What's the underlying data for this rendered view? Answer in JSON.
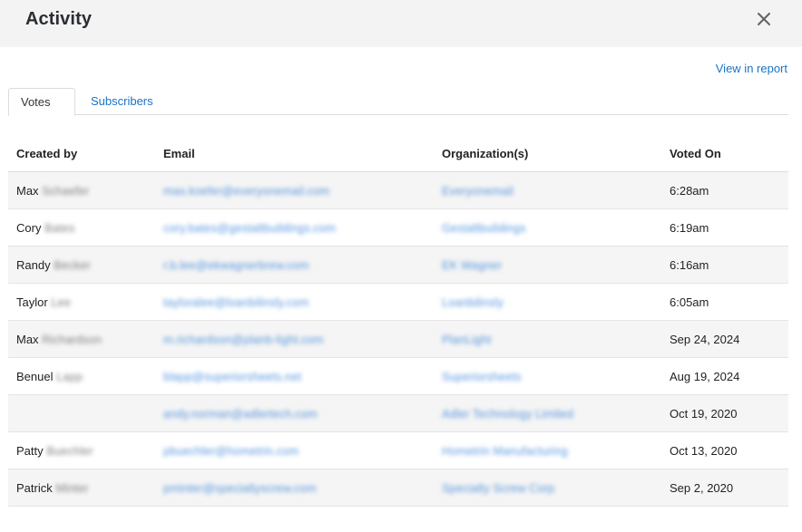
{
  "header": {
    "title": "Activity"
  },
  "actions": {
    "view_report": "View in report"
  },
  "tabs": [
    {
      "label": "Votes",
      "active": true
    },
    {
      "label": "Subscribers",
      "active": false
    }
  ],
  "table": {
    "columns": [
      "Created by",
      "Email",
      "Organization(s)",
      "Voted On"
    ],
    "rows": [
      {
        "first": "Max",
        "last": "Schaefer",
        "email": "max.koefer@everyonemail.com",
        "org": "Everyonemail",
        "voted_on": "6:28am"
      },
      {
        "first": "Cory",
        "last": "Bates",
        "email": "cory.bates@gestaltbuildings.com",
        "org": "Gestaltbuildings",
        "voted_on": "6:19am"
      },
      {
        "first": "Randy",
        "last": "Becker",
        "email": "r.b.lee@ekwagnerbrew.com",
        "org": "EK Wagner",
        "voted_on": "6:16am"
      },
      {
        "first": "Taylor",
        "last": "Lee",
        "email": "tayloralee@loanbilinsly.com",
        "org": "Loanbilinsly",
        "voted_on": "6:05am"
      },
      {
        "first": "Max",
        "last": "Richardson",
        "email": "m.richardson@planb-light.com",
        "org": "PlanLight",
        "voted_on": "Sep 24, 2024"
      },
      {
        "first": "Benuel",
        "last": "Lapp",
        "email": "blapp@superiorsheets.net",
        "org": "Superiorsheets",
        "voted_on": "Aug 19, 2024"
      },
      {
        "first": "",
        "last": "",
        "email": "andy.norman@adlertech.com",
        "org": "Adler Technology Limited",
        "voted_on": "Oct 19, 2020"
      },
      {
        "first": "Patty",
        "last": "Buechler",
        "email": "pbuechler@hometrin.com",
        "org": "Hometrin Manufacturing",
        "voted_on": "Oct 13, 2020"
      },
      {
        "first": "Patrick",
        "last": "Minter",
        "email": "pminter@specialtyscrew.com",
        "org": "Specialty Screw Corp",
        "voted_on": "Sep 2, 2020"
      }
    ]
  },
  "colors": {
    "accent": "#1a73c8",
    "header_bg": "#f3f3f3",
    "row_alt": "#f5f5f5"
  },
  "icons": {
    "close": "close-icon"
  }
}
